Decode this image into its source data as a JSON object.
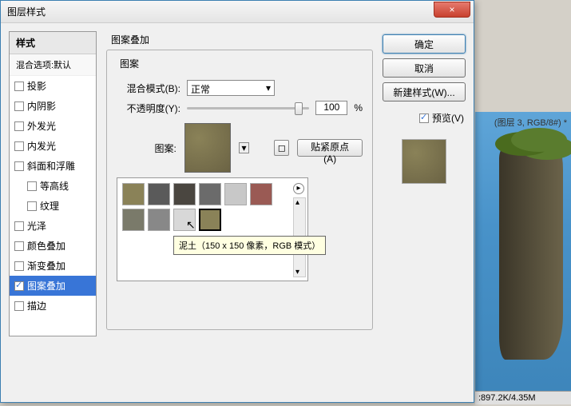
{
  "bg": {
    "doc_title": "(图层 3, RGB/8#) *",
    "status": ":897.2K/4.35M"
  },
  "dialog": {
    "title": "图层样式",
    "close": "×"
  },
  "sidebar": {
    "head": "样式",
    "subhead": "混合选项:默认",
    "items": [
      {
        "label": "投影",
        "indent": false,
        "checked": false,
        "sel": false
      },
      {
        "label": "内阴影",
        "indent": false,
        "checked": false,
        "sel": false
      },
      {
        "label": "外发光",
        "indent": false,
        "checked": false,
        "sel": false
      },
      {
        "label": "内发光",
        "indent": false,
        "checked": false,
        "sel": false
      },
      {
        "label": "斜面和浮雕",
        "indent": false,
        "checked": false,
        "sel": false
      },
      {
        "label": "等高线",
        "indent": true,
        "checked": false,
        "sel": false
      },
      {
        "label": "纹理",
        "indent": true,
        "checked": false,
        "sel": false
      },
      {
        "label": "光泽",
        "indent": false,
        "checked": false,
        "sel": false
      },
      {
        "label": "颜色叠加",
        "indent": false,
        "checked": false,
        "sel": false
      },
      {
        "label": "渐变叠加",
        "indent": false,
        "checked": false,
        "sel": false
      },
      {
        "label": "图案叠加",
        "indent": false,
        "checked": true,
        "sel": true
      },
      {
        "label": "描边",
        "indent": false,
        "checked": false,
        "sel": false
      }
    ]
  },
  "main": {
    "section_title": "图案叠加",
    "fieldset_legend": "图案",
    "blend_label": "混合模式(B):",
    "blend_value": "正常",
    "opacity_label": "不透明度(Y):",
    "opacity_value": "100",
    "opacity_unit": "%",
    "pattern_label": "图案:",
    "snap_btn": "贴紧原点(A)",
    "tooltip": "泥土（150 x 150 像素，RGB 模式）",
    "thumbs_colors": [
      "#8a8258",
      "#5a5a5a",
      "#4a4640",
      "#6b6b6b",
      "#c8c8c8",
      "#9a5a54",
      "#7a7a6a",
      "#888",
      "#d8d8d8",
      "#8a8258"
    ]
  },
  "right": {
    "ok": "确定",
    "cancel": "取消",
    "newstyle": "新建样式(W)...",
    "preview": "预览(V)"
  }
}
